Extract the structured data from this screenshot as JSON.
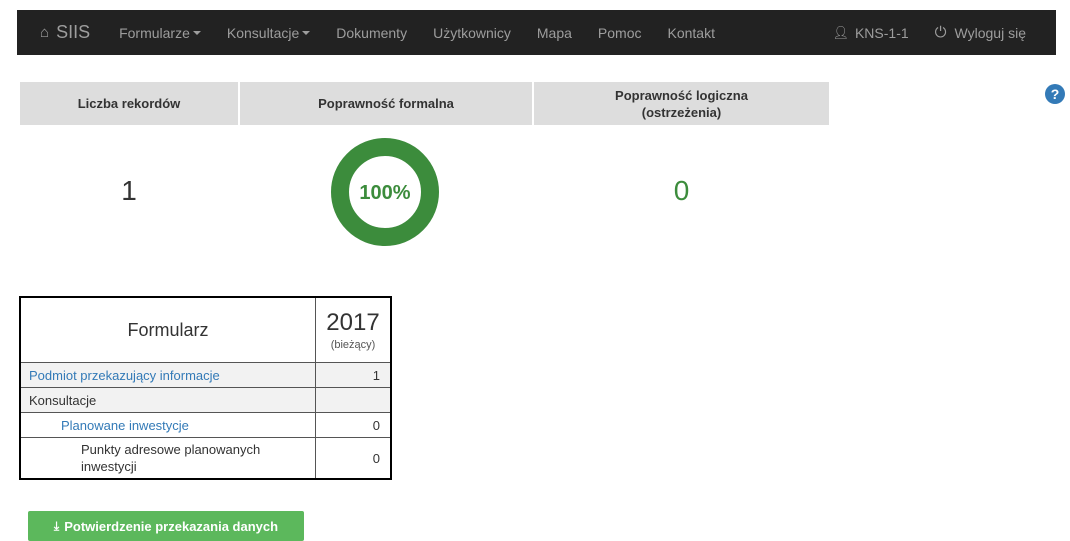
{
  "nav": {
    "brand": "SIIS",
    "items": [
      "Formularze",
      "Konsultacje",
      "Dokumenty",
      "Użytkownicy",
      "Mapa",
      "Pomoc",
      "Kontakt"
    ],
    "user": "KNS-1-1",
    "logout": "Wyloguj się"
  },
  "summary": {
    "records_header": "Liczba rekordów",
    "formal_header": "Poprawność formalna",
    "logical_header_line1": "Poprawność logiczna",
    "logical_header_line2": "(ostrzeżenia)",
    "records_value": "1",
    "formal_value": "100%",
    "formal_fraction": 1.0,
    "logical_value": "0"
  },
  "table": {
    "col_form": "Formularz",
    "col_year": "2017",
    "col_year_sub": "(bieżący)",
    "rows": [
      {
        "label": "Podmiot przekazujący informacje",
        "value": "1"
      },
      {
        "label": "Konsultacje",
        "value": ""
      },
      {
        "label": "Planowane inwestycje",
        "value": "0"
      },
      {
        "label": "Punkty adresowe planowanych inwestycji",
        "value": "0"
      }
    ]
  },
  "button": {
    "confirm": "Potwierdzenie przekazania danych"
  },
  "colors": {
    "navbar": "#222222",
    "success": "#5cb85c",
    "donut": "#3c8c3c",
    "link": "#337ab7"
  }
}
